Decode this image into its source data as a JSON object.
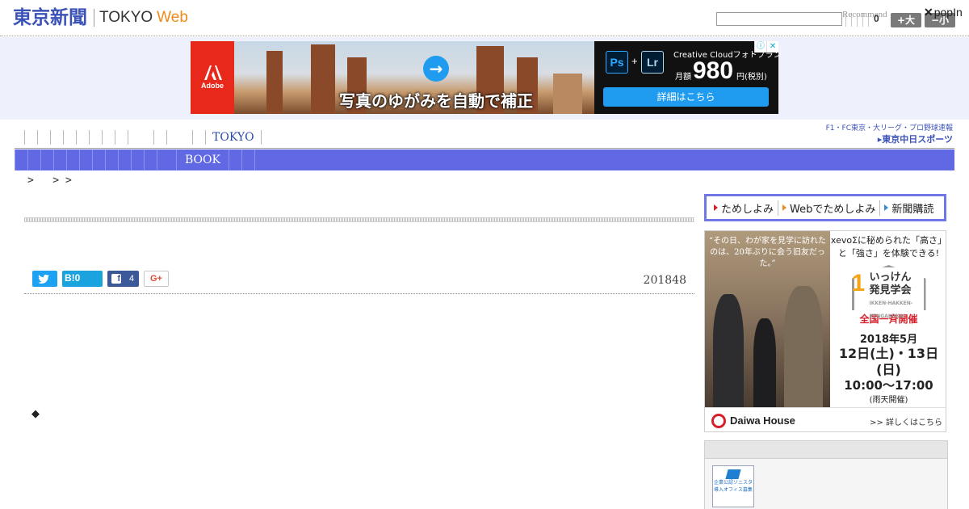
{
  "header": {
    "logo_jp": "東京新聞",
    "logo_tokyo": "TOKYO",
    "logo_web": "Web",
    "recommend": "Recommend",
    "count": "0",
    "size_up": "+大",
    "size_down": "−小",
    "popin": "popIn"
  },
  "ad_banner": {
    "adobe": "Adobe",
    "caption": "写真のゆがみを自動で補正",
    "product": "Creative Cloudフォトプラン",
    "ps": "Ps",
    "lr": "Lr",
    "plus": "+",
    "price_label": "月額",
    "price": "980",
    "price_unit": "円(税別)",
    "cta": "詳細はこちら"
  },
  "nav": {
    "tokyo": "TOKYO",
    "book": "BOOK",
    "chunichi_top": "F1・FC東京・大リーグ・プロ野球速報",
    "chunichi_main": "▸東京中日スポーツ"
  },
  "breadcrumb": ">   > >",
  "article": {
    "hatena": "B!0",
    "facebook_count": "4",
    "gplus": "G+",
    "date": "201848",
    "bullet": "◆"
  },
  "sidebar": {
    "tabs": [
      {
        "label": "ためしよみ",
        "color": "#d6202b"
      },
      {
        "label": "Webでためしよみ",
        "color": "#ee8a2a"
      },
      {
        "label": "新聞購読",
        "color": "#3a8ad0"
      }
    ],
    "daiwa": {
      "quote": "“その日、わが家を見学に訪れたのは、20年ぶりに会う旧友だった。”",
      "head": "xevoΣに秘められた「高さ」と「強さ」を体験できる!",
      "one": "1",
      "event_line1": "いっけん",
      "event_line2": "発見学会",
      "event_sub": "IKKEN-HAKKEN-KENGAKUKAI",
      "red": "全国一斉開催",
      "date1": "2018年5月",
      "date2": "12日(土)・13日(日)",
      "time": "10:00〜17:00",
      "rain": "(雨天開催)",
      "logo": "Daiwa House",
      "more": ">> 詳しくはこちら"
    },
    "cert": "企業公認ソニスタ導入オフィス募集"
  }
}
